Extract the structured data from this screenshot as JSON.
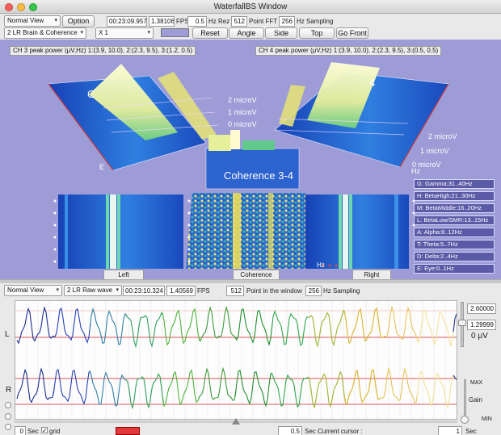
{
  "window": {
    "title": "WaterfallBS Window"
  },
  "toolbar1": {
    "view_mode": "Normal View",
    "option_label": "Option",
    "elapsed_time": "00:23:09.957",
    "fps_value": "1.38106",
    "fps_label": "FPS",
    "hz_rez_value": "0.5",
    "hz_rez_label": "Hz Rez",
    "fft_points": "512",
    "fft_label": "Point FFT",
    "sampling_value": "256",
    "sampling_label": "Hz Sampling"
  },
  "toolbar2": {
    "montage": "2 LR Brain & Coherence",
    "zoom": "X 1",
    "reset_label": "Reset",
    "angle_label": "Angle",
    "side_label": "Side",
    "top_label": "Top",
    "gofront_label": "Go Front"
  },
  "view3d": {
    "ch3_header": "CH 3 peak power (μV,Hz) 1:(3.9, 10.0), 2:(2.3, 9.5), 3:(1.2, 0.5)",
    "ch4_header": "CH 4 peak power (μV,Hz) 1:(3.9, 10.0), 2:(2.3, 9.5), 3:(0.5, 0.5)",
    "left_scale": [
      "2 microV",
      "1 microV",
      "0 microV"
    ],
    "right_scale": [
      "2 microV",
      "1 microV",
      "0 microV"
    ],
    "coherence_title": "Coherence 3-4",
    "left_short": "C",
    "right_short": "4",
    "hz_label": "Hz",
    "e_label": "E",
    "band_legend": [
      "G: Gamma:31..40Hz",
      "H: BetaHigh:21..30Hz",
      "M: BetaMiddle:16..20Hz",
      "L: BetaLow/SMR:13..15Hz",
      "A: Alpha:8..12Hz",
      "T: Theta:5..7Hz",
      "D: Delta:2..4Hz",
      "E: Eye:0..1Hz"
    ],
    "panel_left": "Left",
    "panel_center": "Coherence",
    "panel_right": "Right",
    "colors": {
      "background": "#9d9cd6",
      "spectrogram_base": "#1a4fc0",
      "peak": "#f6f6a8"
    }
  },
  "toolbar3": {
    "view_mode": "Normal View",
    "montage": "2 LR Raw wave",
    "elapsed_time": "00:23:10.324",
    "fps_value": "1.40569",
    "fps_label": "FPS",
    "window_points": "512",
    "window_label": "Point in the window",
    "sampling_value": "256",
    "sampling_label": "Hz Sampling"
  },
  "wave": {
    "channel_left": "L",
    "channel_right": "R",
    "scale_max": "2.60000",
    "scale_mid": "1.29999",
    "scale_zero": "0 μV",
    "max_label": "MAX",
    "gain_label": "Gain",
    "min_label": "MIN"
  },
  "bottom": {
    "start_value": "0",
    "sec_label": "Sec",
    "grid_label": "grid",
    "cursor_value": "0.5",
    "cursor_label": "Sec Current cursor :",
    "step_value": "1",
    "step_label": "Sec"
  }
}
